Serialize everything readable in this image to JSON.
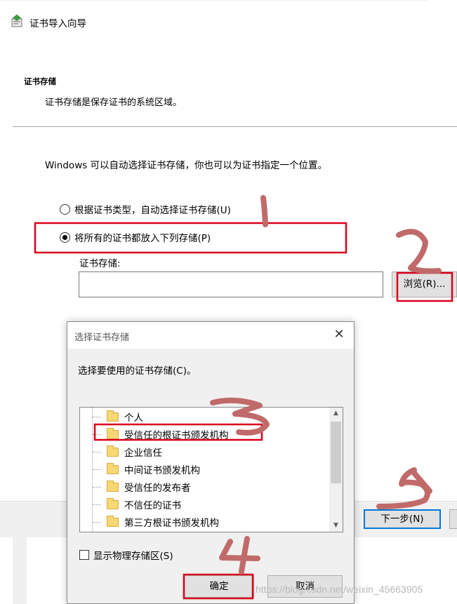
{
  "wizard": {
    "title": "证书导入向导",
    "section_title": "证书存储",
    "section_desc": "证书存储是保存证书的系统区域。",
    "intro": "Windows 可以自动选择证书存储，你也可以为证书指定一个位置。",
    "radio_auto": "根据证书类型，自动选择证书存储(U)",
    "radio_manual": "将所有的证书都放入下列存储(P)",
    "store_label": "证书存储:",
    "store_value": "",
    "browse": "浏览(R)...",
    "next": "下一步(N)"
  },
  "dialog": {
    "title": "选择证书存储",
    "prompt": "选择要使用的证书存储(C)。",
    "items": [
      "个人",
      "受信任的根证书颁发机构",
      "企业信任",
      "中间证书颁发机构",
      "受信任的发布者",
      "不信任的证书",
      "第三方根证书颁发机构"
    ],
    "show_physical": "显示物理存储区(S)",
    "ok": "确定",
    "cancel": "取消"
  },
  "watermark": "https://blog.csdn.net/weixin_45663905",
  "colors": {
    "annotation": "#d9001b",
    "focus_border": "#0078d7",
    "folder": "#f8d775"
  },
  "icons": [
    "certificate-wizard-icon",
    "folder-icon",
    "close-icon",
    "scroll-up-icon",
    "scroll-down-icon"
  ]
}
